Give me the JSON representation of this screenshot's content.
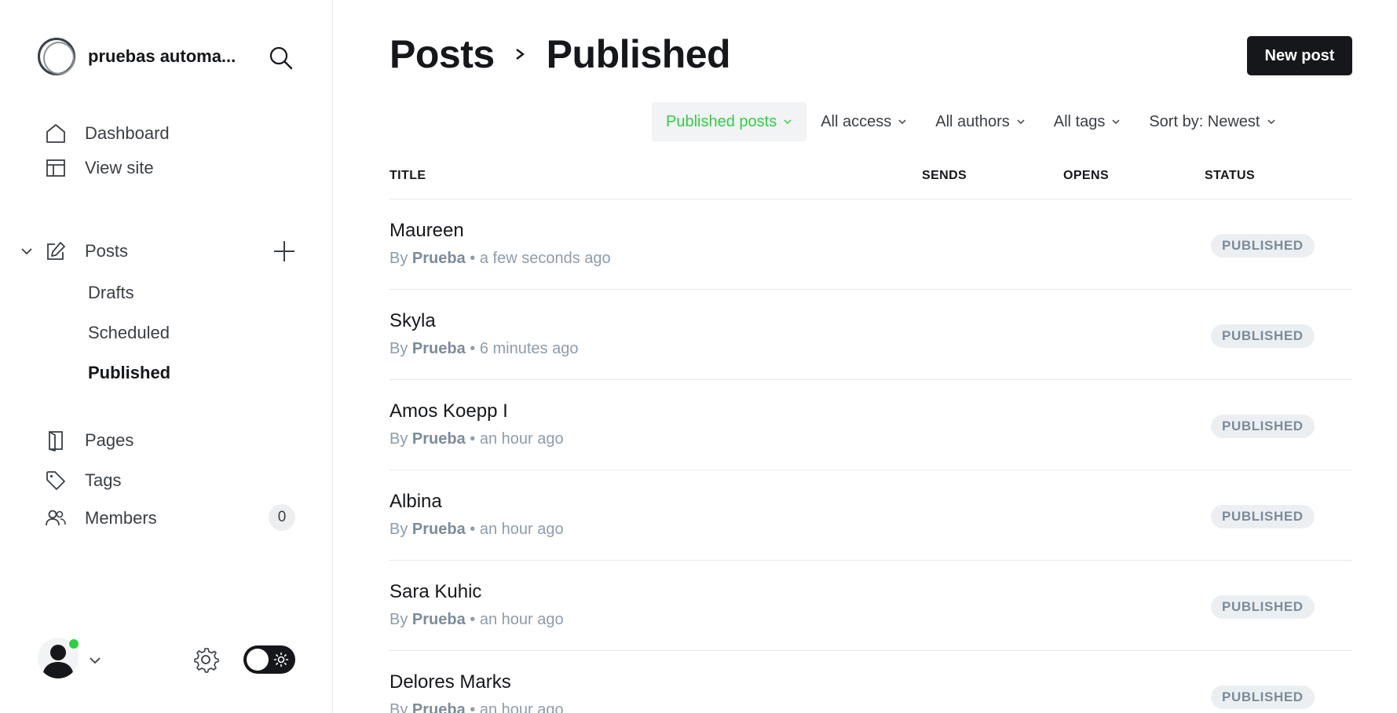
{
  "sidebar": {
    "site_name": "pruebas automa...",
    "nav": {
      "dashboard": "Dashboard",
      "view_site": "View site",
      "posts": "Posts",
      "drafts": "Drafts",
      "scheduled": "Scheduled",
      "published": "Published",
      "pages": "Pages",
      "tags": "Tags",
      "members": "Members",
      "members_count": "0"
    },
    "icons": [
      "search-icon",
      "home-icon",
      "layout-icon",
      "chevron-down-icon",
      "edit-icon",
      "plus-icon",
      "page-icon",
      "tag-icon",
      "members-icon",
      "avatar-icon",
      "gear-icon",
      "sun-icon"
    ]
  },
  "header": {
    "crumb_root": "Posts",
    "crumb_current": "Published",
    "new_post_label": "New post"
  },
  "filters": {
    "type": "Published posts",
    "access": "All access",
    "authors": "All authors",
    "tags": "All tags",
    "sort": "Sort by: Newest"
  },
  "table": {
    "columns": {
      "title": "TITLE",
      "sends": "SENDS",
      "opens": "OPENS",
      "status": "STATUS"
    },
    "rows": [
      {
        "title": "Maureen",
        "by": "By",
        "author": "Prueba",
        "time": "• a few seconds ago",
        "status": "PUBLISHED"
      },
      {
        "title": "Skyla",
        "by": "By",
        "author": "Prueba",
        "time": "• 6 minutes ago",
        "status": "PUBLISHED"
      },
      {
        "title": "Amos Koepp I",
        "by": "By",
        "author": "Prueba",
        "time": "• an hour ago",
        "status": "PUBLISHED"
      },
      {
        "title": "Albina",
        "by": "By",
        "author": "Prueba",
        "time": "• an hour ago",
        "status": "PUBLISHED"
      },
      {
        "title": "Sara Kuhic",
        "by": "By",
        "author": "Prueba",
        "time": "• an hour ago",
        "status": "PUBLISHED"
      },
      {
        "title": "Delores Marks",
        "by": "By",
        "author": "Prueba",
        "time": "• an hour ago",
        "status": "PUBLISHED"
      }
    ]
  },
  "colors": {
    "accent_green": "#30cf43",
    "text_dark": "#15171a",
    "meta_gray": "#8e9cac",
    "badge_bg": "#eceff2"
  }
}
